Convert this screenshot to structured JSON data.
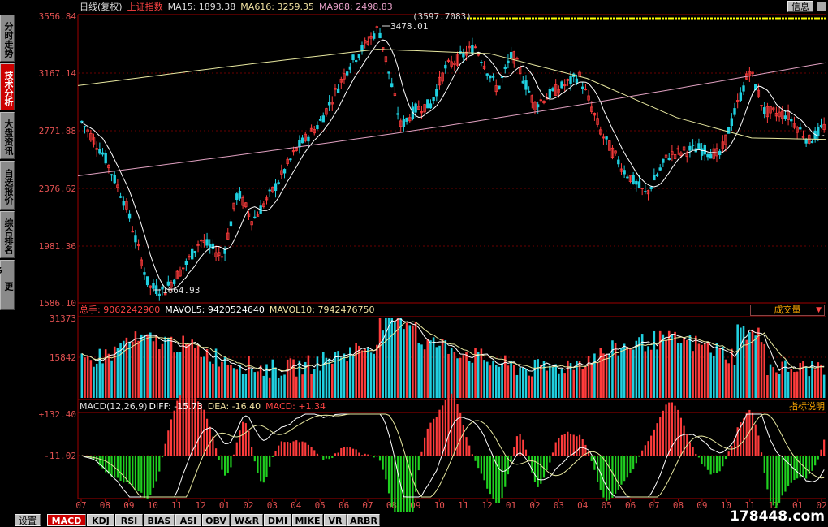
{
  "side_tabs": [
    {
      "label": "分时走势",
      "active": false
    },
    {
      "label": "技术分析",
      "active": true
    },
    {
      "label": "大盘资讯",
      "active": false
    },
    {
      "label": "自选报价",
      "active": false
    },
    {
      "label": "综合排名",
      "active": false
    },
    {
      "label": "更多...",
      "active": false
    }
  ],
  "price_header": {
    "title": "日线(复权)",
    "index_name": "上证指数",
    "ma15": "MA15: 1893.38",
    "ma616": "MA616: 3259.35",
    "ma988": "MA988: 2498.83",
    "info_button": "信息"
  },
  "price_axis": [
    "3556.84",
    "3167.14",
    "2771.88",
    "2376.62",
    "1981.36",
    "1586.10"
  ],
  "price_annotations": {
    "high": "3478.01",
    "low": "1664.93",
    "top_cut": "(3597.7083)"
  },
  "volume_header": {
    "total": "总手: 9062242900",
    "mavol5": "MAVOL5: 9420524640",
    "mavol10": "MAVOL10: 7942476750",
    "selector": "成交量"
  },
  "volume_axis": [
    "31373",
    "15842"
  ],
  "macd_header": {
    "params": "MACD(12,26,9)",
    "diff": "DIFF: -15.73",
    "dea": "DEA: -16.40",
    "macd": "MACD: +1.34",
    "explain": "指标说明"
  },
  "macd_axis": [
    "+132.40",
    "-11.02"
  ],
  "date_labels": [
    "07",
    "08",
    "09",
    "10",
    "11",
    "12",
    "01",
    "02",
    "03",
    "04",
    "05",
    "06",
    "07",
    "08",
    "09",
    "10",
    "11",
    "12",
    "01",
    "02",
    "03",
    "04",
    "05",
    "06",
    "07",
    "08",
    "09",
    "10",
    "11",
    "12",
    "01",
    "02"
  ],
  "bottom_tabs": {
    "settings": "设置",
    "items": [
      {
        "label": "MACD",
        "active": true
      },
      {
        "label": "KDJ",
        "active": false
      },
      {
        "label": "RSI",
        "active": false
      },
      {
        "label": "BIAS",
        "active": false
      },
      {
        "label": "ASI",
        "active": false
      },
      {
        "label": "OBV",
        "active": false
      },
      {
        "label": "W&R",
        "active": false
      },
      {
        "label": "DMI",
        "active": false
      },
      {
        "label": "MIKE",
        "active": false
      },
      {
        "label": "VR",
        "active": false
      },
      {
        "label": "ARBR",
        "active": false
      }
    ]
  },
  "watermark": "178448.com",
  "colors": {
    "up": "#ff3c3c",
    "down": "#20d0e0",
    "ma_short": "#ffffff",
    "ma_long": "#e8e8a0",
    "ma_pink": "#e0a0c0",
    "grid": "#7a0000",
    "axis_text": "#e05050",
    "macd_pos": "#ff3c3c",
    "macd_neg": "#20d020"
  }
}
